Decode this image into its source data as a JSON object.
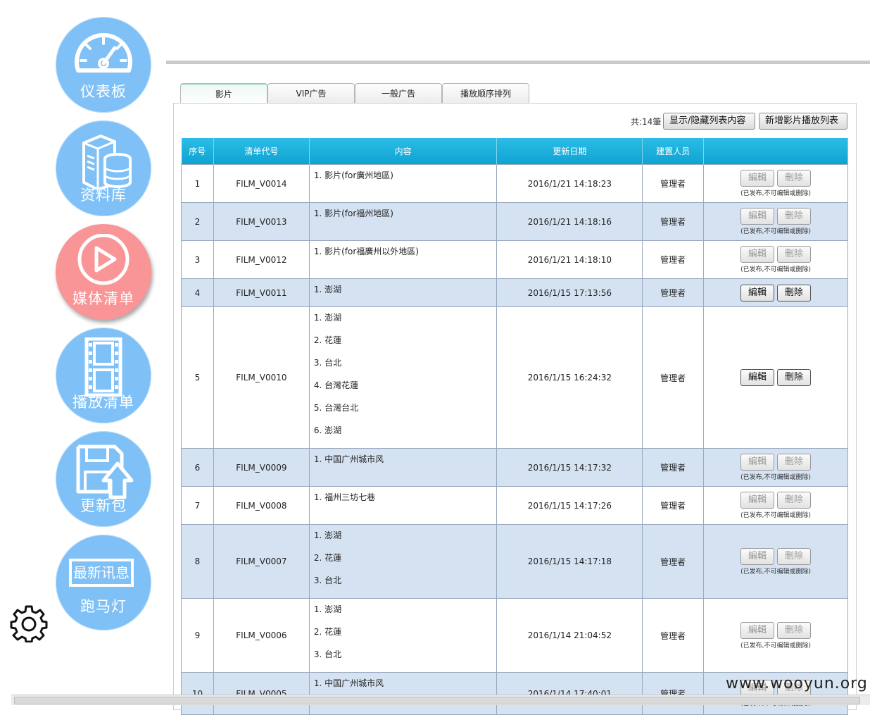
{
  "sidebar": {
    "items": [
      {
        "label": "仪表板",
        "icon": "speedometer-icon"
      },
      {
        "label": "资料库",
        "icon": "database-icon"
      },
      {
        "label": "媒体清单",
        "icon": "play-icon",
        "active": true
      },
      {
        "label": "播放清单",
        "icon": "film-strip-icon"
      },
      {
        "label": "更新包",
        "icon": "floppy-upload-icon"
      },
      {
        "label": "跑马灯",
        "icon": "news-banner-icon",
        "banner_text": "最新讯息"
      }
    ],
    "settings_icon": "gear-icon"
  },
  "tabs": [
    {
      "label": "影片",
      "active": true
    },
    {
      "label": "VIP广告"
    },
    {
      "label": "一般广告"
    },
    {
      "label": "播放顺序排列"
    }
  ],
  "toolbar": {
    "count": "共:14筆",
    "toggle_button": "显示/隐藏列表内容",
    "add_button": "新增影片播放列表"
  },
  "table": {
    "headers": [
      "序号",
      "清单代号",
      "内容",
      "更新日期",
      "建置人员",
      ""
    ],
    "edit_label": "編輯",
    "delete_label": "刪除",
    "locked_note": "(已发布,不可编辑或删除)",
    "rows": [
      {
        "no": "1",
        "code": "FILM_V0014",
        "items": [
          "1. 影片(for廣州地區)"
        ],
        "date": "2016/1/21 14:18:23",
        "creator": "管理者",
        "locked": true
      },
      {
        "no": "2",
        "code": "FILM_V0013",
        "items": [
          "1. 影片(for福州地區)"
        ],
        "date": "2016/1/21 14:18:16",
        "creator": "管理者",
        "locked": true
      },
      {
        "no": "3",
        "code": "FILM_V0012",
        "items": [
          "1. 影片(for福廣州以外地區)"
        ],
        "date": "2016/1/21 14:18:10",
        "creator": "管理者",
        "locked": true
      },
      {
        "no": "4",
        "code": "FILM_V0011",
        "items": [
          "1. 澎湖"
        ],
        "date": "2016/1/15 17:13:56",
        "creator": "管理者",
        "locked": false
      },
      {
        "no": "5",
        "code": "FILM_V0010",
        "items": [
          "1. 澎湖",
          "2. 花蓮",
          "3. 台北",
          "4. 台灣花蓮",
          "5. 台灣台北",
          "6. 澎湖"
        ],
        "date": "2016/1/15 16:24:32",
        "creator": "管理者",
        "locked": false
      },
      {
        "no": "6",
        "code": "FILM_V0009",
        "items": [
          "1. 中国广州城市风"
        ],
        "date": "2016/1/15 14:17:32",
        "creator": "管理者",
        "locked": true
      },
      {
        "no": "7",
        "code": "FILM_V0008",
        "items": [
          "1. 福州三坊七巷"
        ],
        "date": "2016/1/15 14:17:26",
        "creator": "管理者",
        "locked": true
      },
      {
        "no": "8",
        "code": "FILM_V0007",
        "items": [
          "1. 澎湖",
          "2. 花蓮",
          "3. 台北"
        ],
        "date": "2016/1/15 14:17:18",
        "creator": "管理者",
        "locked": true
      },
      {
        "no": "9",
        "code": "FILM_V0006",
        "items": [
          "1. 澎湖",
          "2. 花蓮",
          "3. 台北"
        ],
        "date": "2016/1/14 21:04:52",
        "creator": "管理者",
        "locked": true
      },
      {
        "no": "10",
        "code": "FILM_V0005",
        "items": [
          "1. 中国广州城市风"
        ],
        "date": "2016/1/14 17:40:01",
        "creator": "管理者",
        "locked": true
      }
    ]
  },
  "watermark": "www.wooyun.org",
  "colors": {
    "nav": "#7fc0f6",
    "nav_active": "#f99596",
    "header": "#13a8d8",
    "row_alt": "#d5e2f2"
  }
}
